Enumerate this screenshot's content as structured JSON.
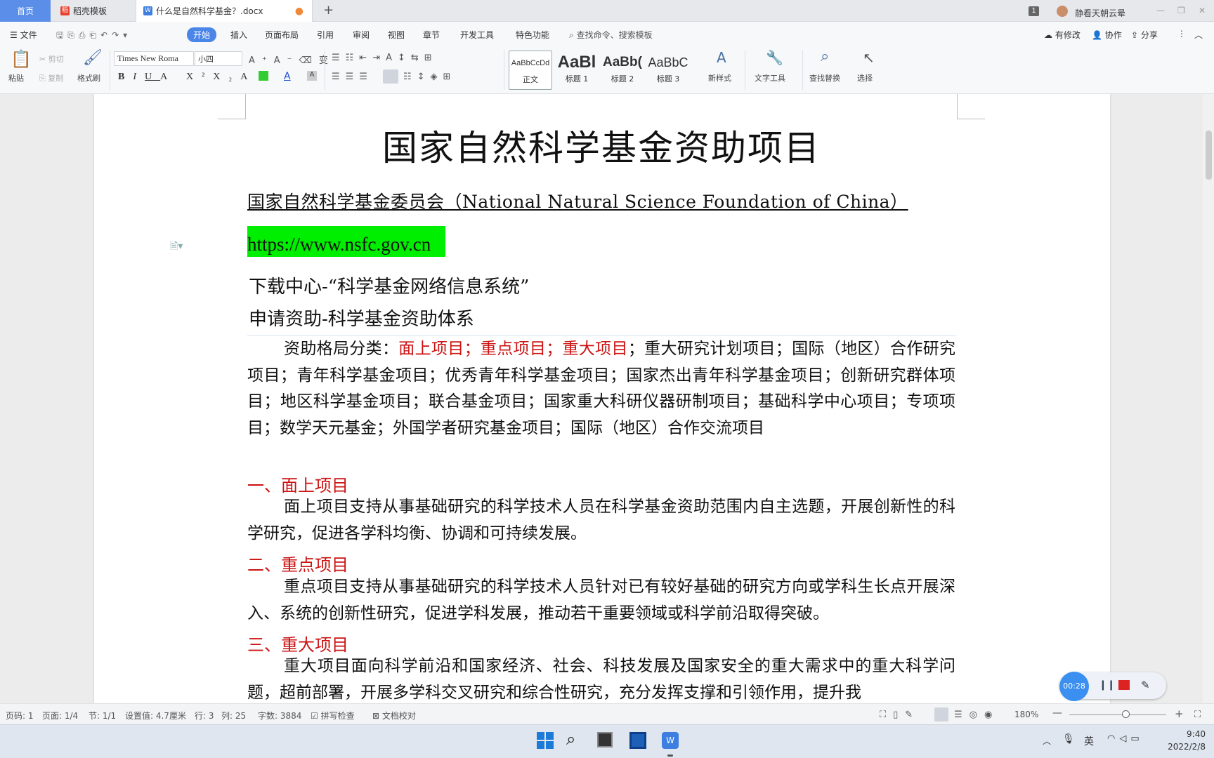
{
  "tabs": {
    "home": "首页",
    "template": "稻壳模板",
    "document": "什么是自然科学基金？.docx",
    "user": "静看天朝云晕",
    "badge": "1"
  },
  "menu": {
    "file": "文件",
    "items": [
      "开始",
      "插入",
      "页面布局",
      "引用",
      "审阅",
      "视图",
      "章节",
      "开发工具",
      "特色功能"
    ],
    "search": "查找命令、搜索模板",
    "has_changes": "有修改",
    "collab": "协作",
    "share": "分享"
  },
  "ribbon": {
    "paste": "粘贴",
    "cut": "剪切",
    "copy": "复制",
    "format_painter": "格式刷",
    "font_name": "Times New Roma",
    "font_size": "小四",
    "styles": [
      {
        "preview": "AaBbCcDd",
        "label": "正文"
      },
      {
        "preview": "AaBl",
        "label": "标题 1"
      },
      {
        "preview": "AaBb(",
        "label": "标题 2"
      },
      {
        "preview": "AaBbC",
        "label": "标题 3"
      }
    ],
    "new_style": "新样式",
    "text_tools": "文字工具",
    "find_replace": "查找替换",
    "select": "选择"
  },
  "document": {
    "title": "国家自然科学基金资助项目",
    "org": "国家自然科学基金委员会（National Natural Science Foundation of China）",
    "url": "https://www.nsfc.gov.cn",
    "line1": "下载中心-“科学基金网络信息系统”",
    "line2": "申请资助-科学基金资助体系",
    "p1_label": "资助格局分类：",
    "p1_red": "面上项目；重点项目；重大项目",
    "p1_rest": "；重大研究计划项目；国际（地区）合作研究项目；青年科学基金项目；优秀青年科学基金项目；国家杰出青年科学基金项目；创新研究群体项目；地区科学基金项目；联合基金项目；国家重大科研仪器研制项目；基础科学中心项目；专项项目；数学天元基金；外国学者研究基金项目；国际（地区）合作交流项目",
    "h_1": "一、面上项目",
    "p_1": "面上项目支持从事基础研究的科学技术人员在科学基金资助范围内自主选题，开展创新性的科学研究，促进各学科均衡、协调和可持续发展。",
    "h_2": "二、重点项目",
    "p_2": "重点项目支持从事基础研究的科学技术人员针对已有较好基础的研究方向或学科生长点开展深入、系统的创新性研究，促进学科发展，推动若干重要领域或科学前沿取得突破。",
    "h_3": "三、重大项目",
    "p_3": "重大项目面向科学前沿和国家经济、社会、科技发展及国家安全的重大需求中的重大科学问题，超前部署，开展多学科交叉研究和综合性研究，充分发挥支撑和引领作用，提升我"
  },
  "status": {
    "page_num": "页码: 1",
    "pages": "页面: 1/4",
    "section": "节: 1/1",
    "setting": "设置值: 4.7厘米",
    "row": "行: 3",
    "col": "列: 25",
    "words": "字数: 3884",
    "spell": "拼写检查",
    "proof": "文档校对",
    "zoom": "180%"
  },
  "recording": {
    "time": "00:28"
  },
  "taskbar": {
    "ime": "英",
    "time": "9:40",
    "date": "2022/2/8"
  },
  "colors": {
    "accent": "#4a86e8",
    "highlight": "#00ee00",
    "heading_red": "#cc1111"
  }
}
